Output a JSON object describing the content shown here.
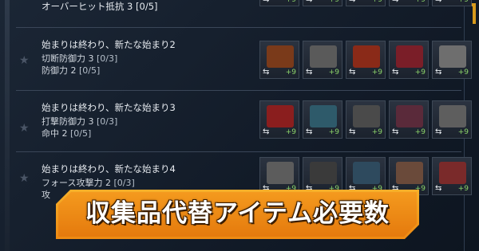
{
  "rows": [
    {
      "title": "オーバーヒット抵抗 3 [0/5]",
      "lines": [],
      "items": [
        {
          "art": "#4a2a22"
        },
        {
          "art": "#3b3b3b"
        },
        {
          "art": "#6a1a1a"
        },
        {
          "art": "#5a2a2a"
        },
        {
          "art": "#4b4b4b"
        }
      ]
    },
    {
      "title": "始まりは終わり、新たな始まり2",
      "lines": [
        {
          "label": "切断防御力",
          "value": "3",
          "progress": "[0/3]"
        },
        {
          "label": "防御力",
          "value": "2",
          "progress": "[0/5]"
        }
      ],
      "items": [
        {
          "art": "#7a3a1a"
        },
        {
          "art": "#5a5a5a"
        },
        {
          "art": "#8a2a18"
        },
        {
          "art": "#7a1e28"
        },
        {
          "art": "#6e6e6e"
        }
      ]
    },
    {
      "title": "始まりは終わり、新たな始まり3",
      "lines": [
        {
          "label": "打撃防御力",
          "value": "3",
          "progress": "[0/3]"
        },
        {
          "label": "命中",
          "value": "2",
          "progress": "[0/5]"
        }
      ],
      "items": [
        {
          "art": "#8a1e1e"
        },
        {
          "art": "#2e5a6a"
        },
        {
          "art": "#4a4a4a"
        },
        {
          "art": "#5a2a3a"
        },
        {
          "art": "#5e5e5e"
        }
      ]
    },
    {
      "title": "始まりは終わり、新たな始まり4",
      "lines": [
        {
          "label": "フォース攻撃力",
          "value": "2",
          "progress": "[0/3]"
        },
        {
          "label": "攻",
          "value": "",
          "progress": ""
        }
      ],
      "items": [
        {
          "art": "#5c5c5c"
        },
        {
          "art": "#3a3a3a"
        },
        {
          "art": "#2e4a5e"
        },
        {
          "art": "#6a4a3a"
        },
        {
          "art": "#7a2a2a"
        }
      ]
    }
  ],
  "item_suffix": "+9",
  "swap_glyph": "⇆",
  "star_glyph": "★",
  "banner": {
    "text": "収集品代替アイテム必要数"
  },
  "colors": {
    "accent": "#f49a1e",
    "plus": "#8bd36a"
  }
}
